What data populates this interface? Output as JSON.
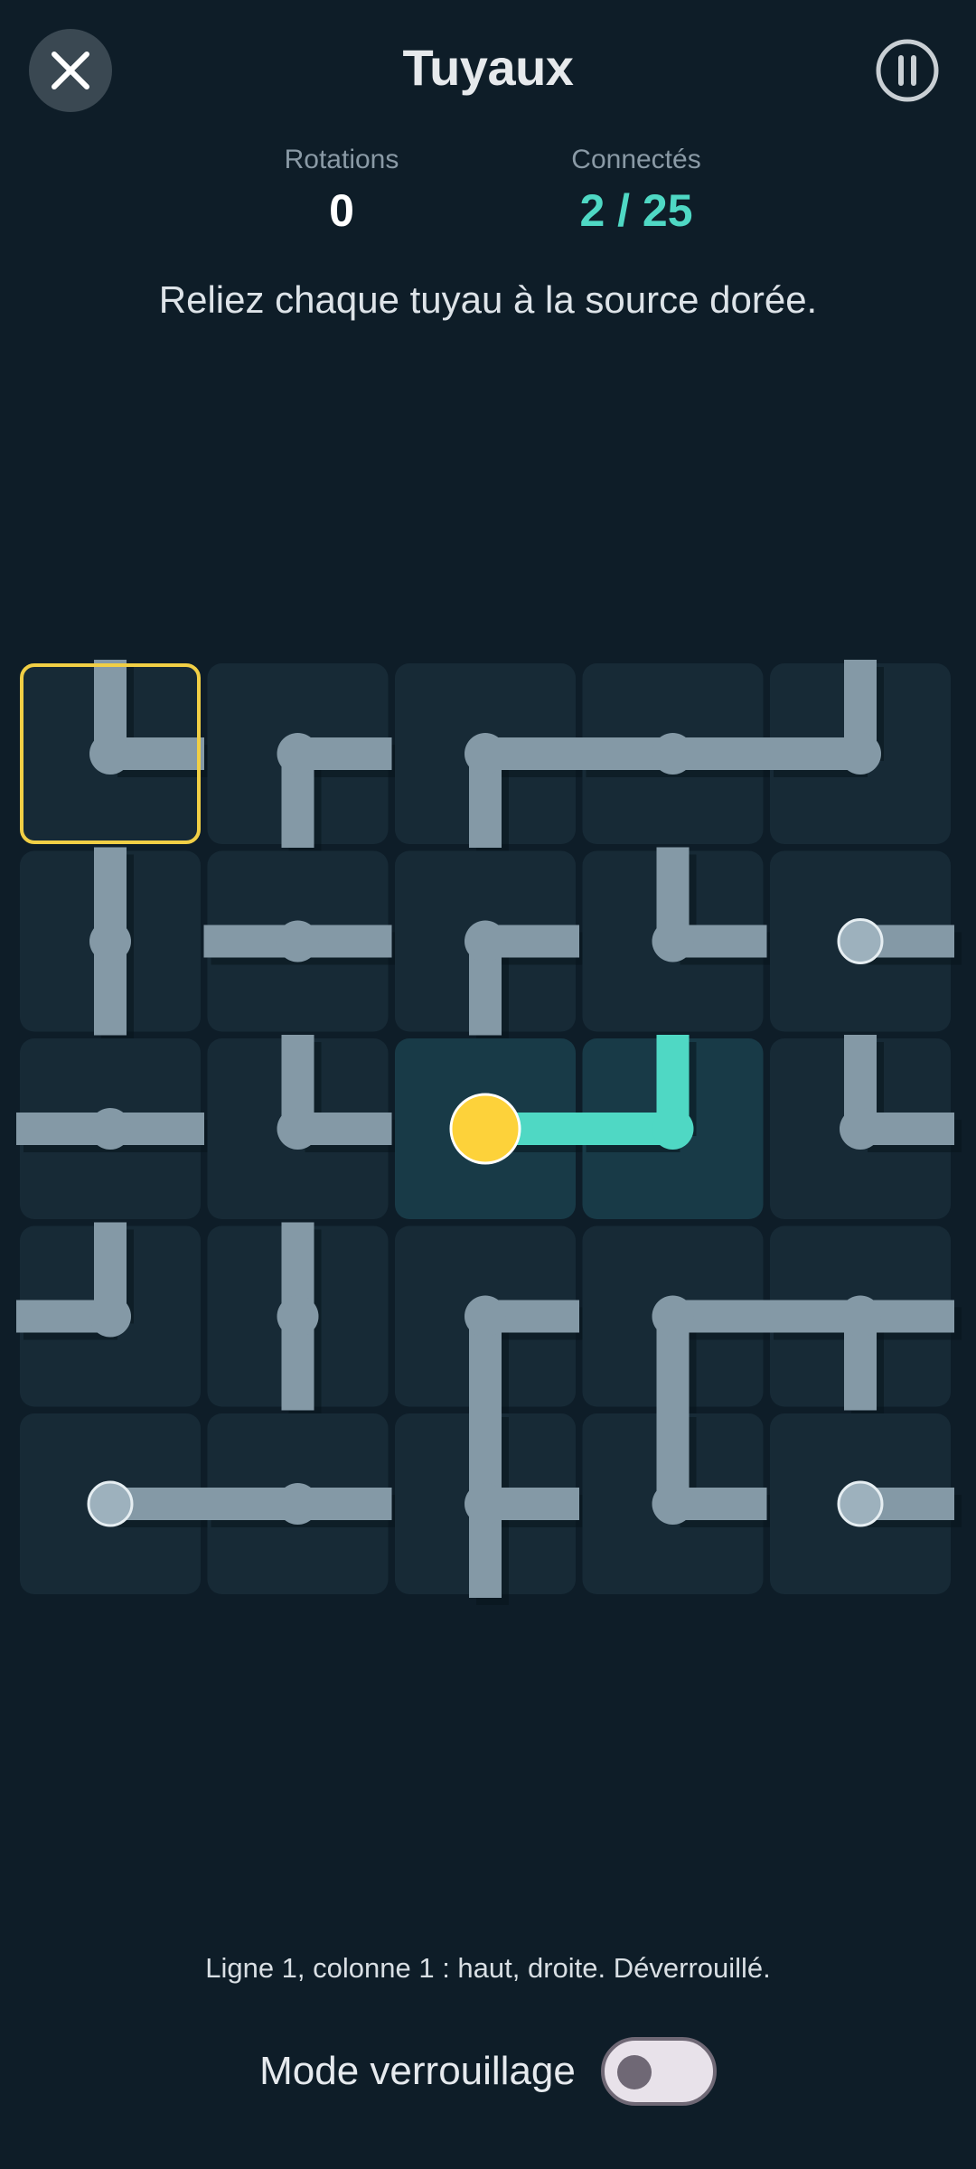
{
  "header": {
    "title": "Tuyaux",
    "close_icon": "close-icon",
    "pause_icon": "pause-icon"
  },
  "stats": {
    "rotations_label": "Rotations",
    "rotations_value": "0",
    "connected_label": "Connectés",
    "connected_value": "2 / 25"
  },
  "instruction": "Reliez chaque tuyau à la source dorée.",
  "colors": {
    "background": "#0e1d28",
    "cell": "#172a36",
    "cell_connected": "#183a47",
    "pipe": "#8499a6",
    "pipe_connected": "#4fd8c4",
    "source": "#fdd23a",
    "selection": "#f1cf45"
  },
  "board": {
    "rows": 5,
    "cols": 5,
    "selected": [
      0,
      0
    ],
    "source": [
      2,
      2
    ],
    "cells": [
      [
        {
          "dirs": [
            "up",
            "right"
          ],
          "type": "corner"
        },
        {
          "dirs": [
            "right",
            "down"
          ],
          "type": "corner"
        },
        {
          "dirs": [
            "right",
            "down"
          ],
          "type": "corner"
        },
        {
          "dirs": [
            "left",
            "right"
          ],
          "type": "straight"
        },
        {
          "dirs": [
            "up",
            "left"
          ],
          "type": "corner"
        }
      ],
      [
        {
          "dirs": [
            "up",
            "down"
          ],
          "type": "straight"
        },
        {
          "dirs": [
            "left",
            "right"
          ],
          "type": "straight"
        },
        {
          "dirs": [
            "right",
            "down"
          ],
          "type": "corner"
        },
        {
          "dirs": [
            "up",
            "right"
          ],
          "type": "corner"
        },
        {
          "dirs": [
            "right"
          ],
          "type": "end"
        }
      ],
      [
        {
          "dirs": [
            "left",
            "right"
          ],
          "type": "straight"
        },
        {
          "dirs": [
            "up",
            "right"
          ],
          "type": "corner"
        },
        {
          "dirs": [
            "right"
          ],
          "type": "source",
          "connected": true
        },
        {
          "dirs": [
            "up",
            "left"
          ],
          "type": "corner",
          "connected": true
        },
        {
          "dirs": [
            "up",
            "right"
          ],
          "type": "corner"
        }
      ],
      [
        {
          "dirs": [
            "up",
            "left"
          ],
          "type": "corner"
        },
        {
          "dirs": [
            "up",
            "down"
          ],
          "type": "straight"
        },
        {
          "dirs": [
            "right",
            "down"
          ],
          "type": "corner"
        },
        {
          "dirs": [
            "right",
            "down"
          ],
          "type": "corner"
        },
        {
          "dirs": [
            "left",
            "right",
            "down"
          ],
          "type": "tee"
        }
      ],
      [
        {
          "dirs": [
            "right"
          ],
          "type": "end"
        },
        {
          "dirs": [
            "left",
            "right"
          ],
          "type": "straight"
        },
        {
          "dirs": [
            "up",
            "right",
            "down"
          ],
          "type": "tee"
        },
        {
          "dirs": [
            "up",
            "right"
          ],
          "type": "corner"
        },
        {
          "dirs": [
            "right"
          ],
          "type": "end"
        }
      ]
    ]
  },
  "status_text": "Ligne 1, colonne 1 : haut, droite. Déverrouillé.",
  "lock_mode": {
    "label": "Mode verrouillage",
    "enabled": false
  }
}
